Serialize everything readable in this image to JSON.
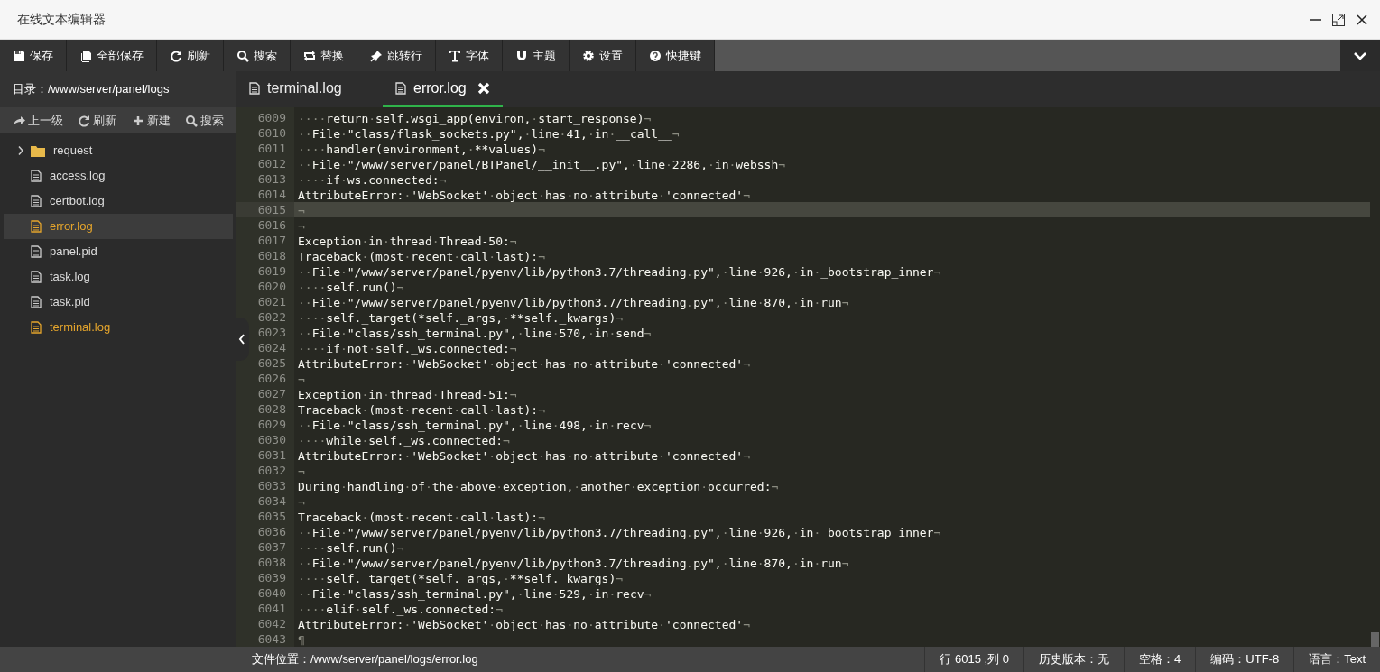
{
  "window": {
    "title": "在线文本编辑器"
  },
  "toolbar": [
    {
      "label": "保存"
    },
    {
      "label": "全部保存"
    },
    {
      "label": "刷新"
    },
    {
      "label": "搜索"
    },
    {
      "label": "替换"
    },
    {
      "label": "跳转行"
    },
    {
      "label": "字体"
    },
    {
      "label": "主题"
    },
    {
      "label": "设置"
    },
    {
      "label": "快捷键"
    }
  ],
  "sidebar": {
    "directory": "目录：/www/server/panel/logs",
    "actions": [
      {
        "label": "上一级"
      },
      {
        "label": "刷新"
      },
      {
        "label": "新建"
      },
      {
        "label": "搜索"
      }
    ],
    "items": [
      {
        "kind": "folder",
        "name": "request",
        "expanded": false,
        "selected": false,
        "open": false
      },
      {
        "kind": "file",
        "name": "access.log",
        "selected": false,
        "open": false
      },
      {
        "kind": "file",
        "name": "certbot.log",
        "selected": false,
        "open": false
      },
      {
        "kind": "file",
        "name": "error.log",
        "selected": true,
        "open": true
      },
      {
        "kind": "file",
        "name": "panel.pid",
        "selected": false,
        "open": false
      },
      {
        "kind": "file",
        "name": "task.log",
        "selected": false,
        "open": false
      },
      {
        "kind": "file",
        "name": "task.pid",
        "selected": false,
        "open": false
      },
      {
        "kind": "file",
        "name": "terminal.log",
        "selected": false,
        "open": true
      }
    ]
  },
  "tabs": [
    {
      "label": "terminal.log",
      "selected": false,
      "closable": false
    },
    {
      "label": "error.log",
      "selected": true,
      "closable": true
    }
  ],
  "editor": {
    "lines": [
      {
        "number": "6009",
        "text": "····return·self.wsgi_app(environ,·start_response)¬",
        "current": false
      },
      {
        "number": "6010",
        "text": "··File·\"class/flask_sockets.py\",·line·41,·in·__call__¬",
        "current": false
      },
      {
        "number": "6011",
        "text": "····handler(environment,·**values)¬",
        "current": false
      },
      {
        "number": "6012",
        "text": "··File·\"/www/server/panel/BTPanel/__init__.py\",·line·2286,·in·webssh¬",
        "current": false
      },
      {
        "number": "6013",
        "text": "····if·ws.connected:¬",
        "current": false
      },
      {
        "number": "6014",
        "text": "AttributeError:·'WebSocket'·object·has·no·attribute·'connected'¬",
        "current": false
      },
      {
        "number": "6015",
        "text": "¬",
        "current": true
      },
      {
        "number": "6016",
        "text": "¬",
        "current": false
      },
      {
        "number": "6017",
        "text": "Exception·in·thread·Thread-50:¬",
        "current": false
      },
      {
        "number": "6018",
        "text": "Traceback·(most·recent·call·last):¬",
        "current": false
      },
      {
        "number": "6019",
        "text": "··File·\"/www/server/panel/pyenv/lib/python3.7/threading.py\",·line·926,·in·_bootstrap_inner¬",
        "current": false
      },
      {
        "number": "6020",
        "text": "····self.run()¬",
        "current": false
      },
      {
        "number": "6021",
        "text": "··File·\"/www/server/panel/pyenv/lib/python3.7/threading.py\",·line·870,·in·run¬",
        "current": false
      },
      {
        "number": "6022",
        "text": "····self._target(*self._args,·**self._kwargs)¬",
        "current": false
      },
      {
        "number": "6023",
        "text": "··File·\"class/ssh_terminal.py\",·line·570,·in·send¬",
        "current": false
      },
      {
        "number": "6024",
        "text": "····if·not·self._ws.connected:¬",
        "current": false
      },
      {
        "number": "6025",
        "text": "AttributeError:·'WebSocket'·object·has·no·attribute·'connected'¬",
        "current": false
      },
      {
        "number": "6026",
        "text": "¬",
        "current": false
      },
      {
        "number": "6027",
        "text": "Exception·in·thread·Thread-51:¬",
        "current": false
      },
      {
        "number": "6028",
        "text": "Traceback·(most·recent·call·last):¬",
        "current": false
      },
      {
        "number": "6029",
        "text": "··File·\"class/ssh_terminal.py\",·line·498,·in·recv¬",
        "current": false
      },
      {
        "number": "6030",
        "text": "····while·self._ws.connected:¬",
        "current": false
      },
      {
        "number": "6031",
        "text": "AttributeError:·'WebSocket'·object·has·no·attribute·'connected'¬",
        "current": false
      },
      {
        "number": "6032",
        "text": "¬",
        "current": false
      },
      {
        "number": "6033",
        "text": "During·handling·of·the·above·exception,·another·exception·occurred:¬",
        "current": false
      },
      {
        "number": "6034",
        "text": "¬",
        "current": false
      },
      {
        "number": "6035",
        "text": "Traceback·(most·recent·call·last):¬",
        "current": false
      },
      {
        "number": "6036",
        "text": "··File·\"/www/server/panel/pyenv/lib/python3.7/threading.py\",·line·926,·in·_bootstrap_inner¬",
        "current": false
      },
      {
        "number": "6037",
        "text": "····self.run()¬",
        "current": false
      },
      {
        "number": "6038",
        "text": "··File·\"/www/server/panel/pyenv/lib/python3.7/threading.py\",·line·870,·in·run¬",
        "current": false
      },
      {
        "number": "6039",
        "text": "····self._target(*self._args,·**self._kwargs)¬",
        "current": false
      },
      {
        "number": "6040",
        "text": "··File·\"class/ssh_terminal.py\",·line·529,·in·recv¬",
        "current": false
      },
      {
        "number": "6041",
        "text": "····elif·self._ws.connected:¬",
        "current": false
      },
      {
        "number": "6042",
        "text": "AttributeError:·'WebSocket'·object·has·no·attribute·'connected'¬",
        "current": false
      },
      {
        "number": "6043",
        "text": "¶",
        "current": false
      }
    ]
  },
  "status_bar": {
    "file_path": "文件位置：/www/server/panel/logs/error.log",
    "items": [
      "行 6015 ,列 0",
      "历史版本：无",
      "空格：4",
      "编码：UTF-8",
      "语言：Text"
    ]
  }
}
